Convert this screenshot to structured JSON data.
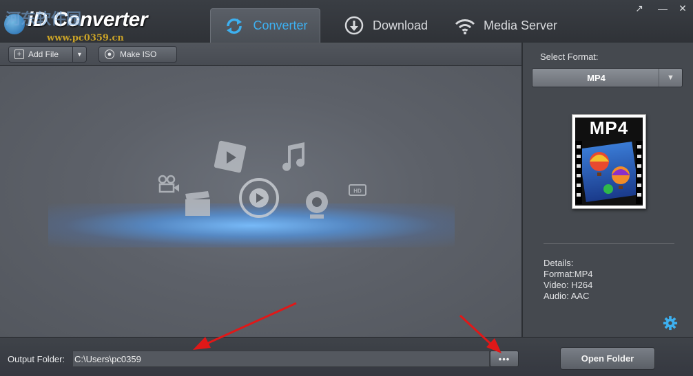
{
  "app": {
    "title": "iD Converter",
    "watermark_text": "河东软件园",
    "watermark_url": "www.pc0359.cn"
  },
  "tabs": [
    {
      "label": "Converter",
      "icon": "refresh-icon",
      "active": true
    },
    {
      "label": "Download",
      "icon": "download-icon",
      "active": false
    },
    {
      "label": "Media Server",
      "icon": "wifi-icon",
      "active": false
    }
  ],
  "window_controls": {
    "restore": "↗",
    "minimize": "—",
    "close": "✕"
  },
  "toolbar": {
    "add_file_label": "Add File",
    "make_iso_label": "Make ISO"
  },
  "format_panel": {
    "select_label": "Select Format:",
    "selected_format": "MP4",
    "thumbnail_label": "MP4",
    "details": {
      "heading": "Details:",
      "format": "Format:MP4",
      "video": "Video: H264",
      "audio": "Audio: AAC"
    }
  },
  "bottom": {
    "output_label": "Output Folder:",
    "output_path": "C:\\Users\\pc0359",
    "browse_label": "•••",
    "open_folder_label": "Open Folder"
  },
  "colors": {
    "accent": "#3db0f0",
    "annotation_arrow": "#e01818"
  }
}
